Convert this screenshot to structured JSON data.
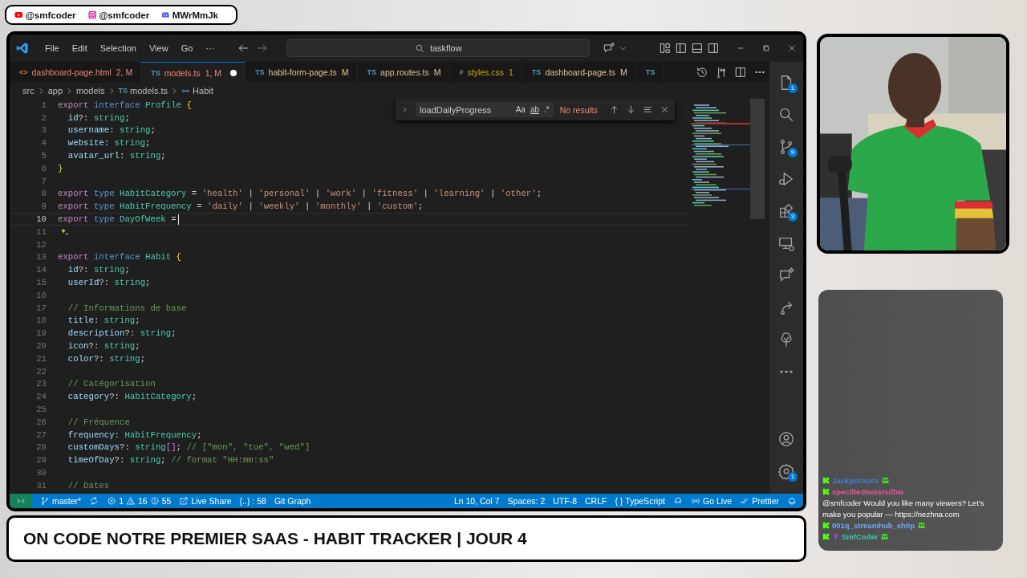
{
  "social": [
    {
      "kind": "youtube",
      "handle": "@smfcoder"
    },
    {
      "kind": "instagram",
      "handle": "@smfcoder"
    },
    {
      "kind": "discord",
      "handle": "MWrMmJk"
    }
  ],
  "window": {
    "menu": [
      "File",
      "Edit",
      "Selection",
      "View",
      "Go",
      "···"
    ],
    "search": "taskflow"
  },
  "tabs": [
    {
      "kind": "html",
      "icon": "<>",
      "label": "dashboard-page.html",
      "status": "2, M",
      "errors": true,
      "warnings": false,
      "selected": false,
      "dirty": false
    },
    {
      "kind": "ts",
      "icon": "TS",
      "label": "models.ts",
      "status": "1, M",
      "errors": true,
      "warnings": false,
      "selected": true,
      "dirty": true
    },
    {
      "kind": "ts",
      "icon": "TS",
      "label": "habit-form-page.ts",
      "status": "M",
      "errors": false,
      "warnings": false,
      "selected": false,
      "dirty": false
    },
    {
      "kind": "ts",
      "icon": "TS",
      "label": "app.routes.ts",
      "status": "M",
      "errors": false,
      "warnings": false,
      "selected": false,
      "dirty": false
    },
    {
      "kind": "css",
      "icon": "#",
      "label": "styles.css",
      "status": "1",
      "errors": false,
      "warnings": true,
      "selected": false,
      "dirty": false
    },
    {
      "kind": "ts",
      "icon": "TS",
      "label": "dashboard-page.ts",
      "status": "M",
      "errors": false,
      "warnings": false,
      "selected": false,
      "dirty": false
    },
    {
      "kind": "ts",
      "icon": "TS",
      "selected": false,
      "dirty": false
    }
  ],
  "breadcrumb": [
    {
      "kind": "folder",
      "label": "src"
    },
    {
      "kind": "folder",
      "label": "app"
    },
    {
      "kind": "folder",
      "label": "models"
    },
    {
      "kind": "file",
      "icon": "TS",
      "label": "models.ts"
    },
    {
      "kind": "symbol",
      "label": "Habit"
    }
  ],
  "find": {
    "value": "loadDailyProgress",
    "options": [
      "Aa",
      "ab",
      ".*"
    ],
    "result": "No results"
  },
  "editor": {
    "lines": [
      {
        "n": "1",
        "kind": "code",
        "current": false,
        "text": "export interface Profile {"
      },
      {
        "n": "2",
        "kind": "code",
        "current": false,
        "text": "  id?: string;"
      },
      {
        "n": "3",
        "kind": "code",
        "current": false,
        "text": "  username: string;"
      },
      {
        "n": "4",
        "kind": "code",
        "current": false,
        "text": "  website: string;"
      },
      {
        "n": "5",
        "kind": "code",
        "current": false,
        "text": "  avatar_url: string;"
      },
      {
        "n": "6",
        "kind": "code",
        "current": false,
        "text": "}"
      },
      {
        "n": "7",
        "kind": "code",
        "current": false
      },
      {
        "n": "8",
        "kind": "code",
        "current": false,
        "text": "export type HabitCategory = 'health' | 'personal' | 'work' | 'fitness' | 'learning' | 'other';"
      },
      {
        "n": "9",
        "kind": "code",
        "current": false,
        "text": "export type HabitFrequency = 'daily' | 'weekly' | 'monthly' | 'custom';"
      },
      {
        "n": "10",
        "kind": "code",
        "current": true,
        "text": "export type DayOfWeek ="
      },
      {
        "n": "11",
        "kind": "hint",
        "current": false
      },
      {
        "n": "12",
        "kind": "code",
        "current": false
      },
      {
        "n": "13",
        "kind": "code",
        "current": false,
        "text": "export interface Habit {"
      },
      {
        "n": "14",
        "kind": "code",
        "current": false,
        "text": "  id?: string;"
      },
      {
        "n": "15",
        "kind": "code",
        "current": false,
        "text": "  userId?: string;"
      },
      {
        "n": "16",
        "kind": "code",
        "current": false
      },
      {
        "n": "17",
        "kind": "code",
        "current": false,
        "text": "  // Informations de base"
      },
      {
        "n": "18",
        "kind": "code",
        "current": false,
        "text": "  title: string;"
      },
      {
        "n": "19",
        "kind": "code",
        "current": false,
        "text": "  description?: string;"
      },
      {
        "n": "20",
        "kind": "code",
        "current": false,
        "text": "  icon?: string;"
      },
      {
        "n": "21",
        "kind": "code",
        "current": false,
        "text": "  color?: string;"
      },
      {
        "n": "22",
        "kind": "code",
        "current": false
      },
      {
        "n": "23",
        "kind": "code",
        "current": false,
        "text": "  // Catégorisation"
      },
      {
        "n": "24",
        "kind": "code",
        "current": false,
        "text": "  category?: HabitCategory;"
      },
      {
        "n": "25",
        "kind": "code",
        "current": false
      },
      {
        "n": "26",
        "kind": "code",
        "current": false,
        "text": "  // Fréquence"
      },
      {
        "n": "27",
        "kind": "code",
        "current": false,
        "text": "  frequency: HabitFrequency;"
      },
      {
        "n": "28",
        "kind": "code",
        "current": false,
        "text": "  customDays?: string[]; // [\"mon\", \"tue\", \"wed\"]"
      },
      {
        "n": "29",
        "kind": "code",
        "current": false,
        "text": "  timeOfDay?: string; // format \"HH:mm:ss\""
      },
      {
        "n": "30",
        "kind": "code",
        "current": false
      },
      {
        "n": "31",
        "kind": "code",
        "current": false,
        "text": "  // Dates"
      }
    ]
  },
  "status_bar": {
    "left": [
      {
        "kind": "remote"
      },
      {
        "kind": "branch",
        "text": "master*"
      },
      {
        "kind": "sync"
      },
      {
        "kind": "problems",
        "errors": "1",
        "warnings": "16",
        "infos": "55"
      },
      {
        "kind": "liveshare",
        "text": "Live Share"
      },
      {
        "kind": "plain",
        "text": "{..} : 58"
      },
      {
        "kind": "plain",
        "text": "Git Graph"
      }
    ],
    "right": [
      {
        "kind": "plain",
        "text": "Ln 10, Col 7"
      },
      {
        "kind": "plain",
        "text": "Spaces: 2"
      },
      {
        "kind": "plain",
        "text": "UTF-8"
      },
      {
        "kind": "plain",
        "text": "CRLF"
      },
      {
        "kind": "language",
        "icon": "{ }",
        "text": "TypeScript"
      },
      {
        "kind": "copilot"
      },
      {
        "kind": "golive",
        "text": "Go Live"
      },
      {
        "kind": "prettier",
        "text": "Prettier"
      },
      {
        "kind": "bell"
      }
    ]
  },
  "activity_bar": {
    "top": [
      {
        "kind": "explorer",
        "badge": "1"
      },
      {
        "kind": "search"
      },
      {
        "kind": "scm",
        "badge": "9"
      },
      {
        "kind": "debug"
      },
      {
        "kind": "extensions",
        "badge": "3"
      },
      {
        "kind": "remote"
      },
      {
        "kind": "chat"
      },
      {
        "kind": "share"
      },
      {
        "kind": "tree"
      },
      {
        "kind": "more"
      }
    ],
    "bottom": [
      {
        "kind": "account"
      },
      {
        "kind": "settings",
        "badge": "1"
      }
    ]
  },
  "chat": [
    {
      "user": "JackpotAura",
      "color": "#3f7fe0",
      "emote": true,
      "badge": false
    },
    {
      "user": "specifiedwaistsdbw",
      "color": "#e0569a",
      "emote": false,
      "badge": false,
      "text": "@smfcoder Would you like many viewers? Let's make you popular — https://nezhna.com"
    },
    {
      "user": "001q_streamhub_sh0p",
      "color": "#6fa8f5",
      "emote": true,
      "badge": false
    },
    {
      "user": "SmfCoder",
      "color": "#35c9b5",
      "emote": true,
      "badge": true
    }
  ],
  "title": "ON CODE NOTRE PREMIER SAAS - HABIT TRACKER | JOUR 4"
}
